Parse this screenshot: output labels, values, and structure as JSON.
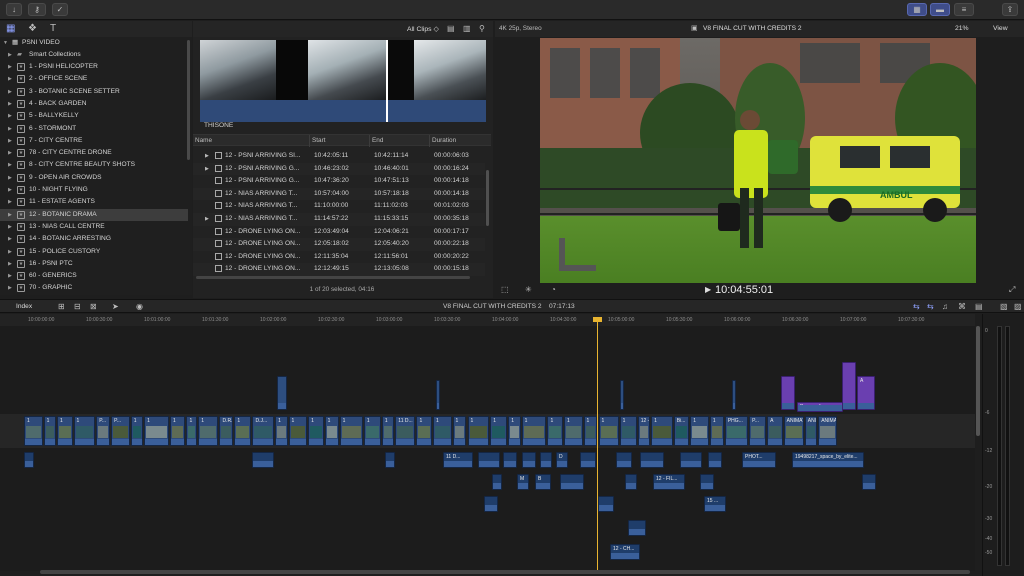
{
  "toolbar": {
    "import_icon": "download-icon",
    "keywords_icon": "key-icon",
    "background_tasks_icon": "check-circle-icon",
    "share_icon": "share-icon"
  },
  "library": {
    "name": "PSNI VIDEO",
    "smart_collections": "Smart Collections",
    "events": [
      "1 - PSNI HELICOPTER",
      "2 - OFFICE SCENE",
      "3 - BOTANIC SCENE SETTER",
      "4 - BACK GARDEN",
      "5 - BALLYKELLY",
      "6 - STORMONT",
      "7 - CITY CENTRE",
      "78 - CITY CENTRE DRONE",
      "8 - CITY CENTRE BEAUTY SHOTS",
      "9 - OPEN AIR CROWDS",
      "10 - NIGHT FLYING",
      "11 - ESTATE AGENTS",
      "12 - BOTANIC DRAMA",
      "13 - NIAS CALL CENTRE",
      "14 - BOTANIC ARRESTING",
      "15 - POLICE CUSTORY",
      "16 - PSNI PTC",
      "60 - GENERICS",
      "70 - GRAPHIC"
    ],
    "selected_index": 12
  },
  "browser": {
    "filter": "All Clips ◇",
    "filmstrip_label": "THISONE",
    "columns": [
      "Name",
      "Start",
      "End",
      "Duration"
    ],
    "rows": [
      {
        "name": "12 - PSNI ARRIVING SI...",
        "start": "10:42:05:11",
        "end": "10:42:11:14",
        "duration": "00:00:06:03",
        "expand": true
      },
      {
        "name": "12 - PSNI ARRIVING G...",
        "start": "10:46:23:02",
        "end": "10:46:40:01",
        "duration": "00:00:16:24",
        "expand": true
      },
      {
        "name": "12 - PSNI ARRIVING G...",
        "start": "10:47:36:20",
        "end": "10:47:51:13",
        "duration": "00:00:14:18",
        "expand": false
      },
      {
        "name": "12 - NIAS ARRIVING T...",
        "start": "10:57:04:00",
        "end": "10:57:18:18",
        "duration": "00:00:14:18",
        "expand": false
      },
      {
        "name": "12 - NIAS ARRIVING T...",
        "start": "11:10:00:00",
        "end": "11:11:02:03",
        "duration": "00:01:02:03",
        "expand": false
      },
      {
        "name": "12 - NIAS ARRIVING T...",
        "start": "11:14:57:22",
        "end": "11:15:33:15",
        "duration": "00:00:35:18",
        "expand": true
      },
      {
        "name": "12 - DRONE LYING ON...",
        "start": "12:03:49:04",
        "end": "12:04:06:21",
        "duration": "00:00:17:17",
        "expand": false
      },
      {
        "name": "12 - DRONE LYING ON...",
        "start": "12:05:18:02",
        "end": "12:05:40:20",
        "duration": "00:00:22:18",
        "expand": false
      },
      {
        "name": "12 - DRONE LYING ON...",
        "start": "12:11:35:04",
        "end": "12:11:56:01",
        "duration": "00:00:20:22",
        "expand": false
      },
      {
        "name": "12 - DRONE LYING ON...",
        "start": "12:12:49:15",
        "end": "12:13:05:08",
        "duration": "00:00:15:18",
        "expand": false
      }
    ],
    "status": "1 of 20 selected, 04:16"
  },
  "viewer": {
    "format": "4K 25p, Stereo",
    "title": "V8 FINAL CUT WITH CREDITS 2",
    "zoom": "21%",
    "view_menu": "View",
    "timecode": "10:04:55:01",
    "vehicle_text": "AMBUL"
  },
  "timeline": {
    "index_label": "Index",
    "project": "V8 FINAL CUT WITH CREDITS 2",
    "duration": "07:17:13",
    "ruler": [
      "10:00:00:00",
      "10:00:30:00",
      "10:01:00:00",
      "10:01:30:00",
      "10:02:00:00",
      "10:02:30:00",
      "10:03:00:00",
      "10:03:30:00",
      "10:04:00:00",
      "10:04:30:00",
      "10:05:00:00",
      "10:05:30:00",
      "10:06:00:00",
      "10:06:30:00",
      "10:07:00:00",
      "10:07:30:00"
    ],
    "labels": {
      "paramedic": "Paramedic...",
      "animat": "ANIMAT...",
      "space": "19498217_space_by_elite...",
      "phot": "PHOT...",
      "ch": "12 - CH...",
      "fil": "12 - FIL...",
      "p": "12 - P...",
      "dro": "D.R.O...",
      "dji": "D.J...",
      "eleven": "11 D...",
      "one": "1",
      "fifteen": "15 ...",
      "a": "A",
      "m": "M",
      "b": "B",
      "d": "D",
      "phg": "PHG...",
      "p_short": "P...",
      "bi": "Bi..."
    }
  },
  "meters": [
    "0",
    "-6",
    "-12",
    "-20",
    "-30",
    "-40",
    "-50"
  ]
}
